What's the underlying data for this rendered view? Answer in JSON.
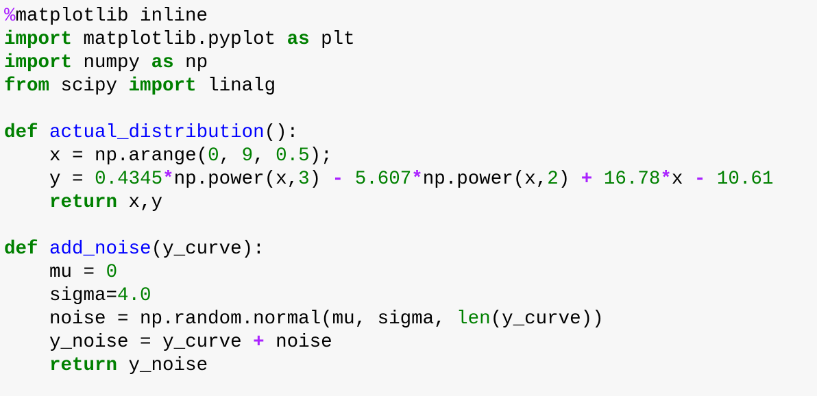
{
  "colors": {
    "background": "#f7f7f7",
    "keyword": "#008000",
    "function_name": "#0000ff",
    "number": "#008000",
    "operator": "#aa22ff",
    "text": "#000000"
  },
  "code_lines": [
    [
      {
        "text": "%",
        "kind": "magic"
      },
      {
        "text": "matplotlib inline",
        "kind": "t"
      }
    ],
    [
      {
        "text": "import",
        "kind": "kw"
      },
      {
        "text": " matplotlib.pyplot ",
        "kind": "t"
      },
      {
        "text": "as",
        "kind": "kw"
      },
      {
        "text": " plt",
        "kind": "t"
      }
    ],
    [
      {
        "text": "import",
        "kind": "kw"
      },
      {
        "text": " numpy ",
        "kind": "t"
      },
      {
        "text": "as",
        "kind": "kw"
      },
      {
        "text": " np",
        "kind": "t"
      }
    ],
    [
      {
        "text": "from",
        "kind": "kw"
      },
      {
        "text": " scipy ",
        "kind": "t"
      },
      {
        "text": "import",
        "kind": "kw"
      },
      {
        "text": " linalg",
        "kind": "t"
      }
    ],
    [],
    [
      {
        "text": "def",
        "kind": "kw"
      },
      {
        "text": " ",
        "kind": "t"
      },
      {
        "text": "actual_distribution",
        "kind": "fn"
      },
      {
        "text": "():",
        "kind": "t"
      }
    ],
    [
      {
        "text": "    x ",
        "kind": "t"
      },
      {
        "text": "=",
        "kind": "t"
      },
      {
        "text": " np.arange(",
        "kind": "t"
      },
      {
        "text": "0",
        "kind": "num"
      },
      {
        "text": ", ",
        "kind": "t"
      },
      {
        "text": "9",
        "kind": "num"
      },
      {
        "text": ", ",
        "kind": "t"
      },
      {
        "text": "0.5",
        "kind": "num"
      },
      {
        "text": ");",
        "kind": "t"
      }
    ],
    [
      {
        "text": "    y ",
        "kind": "t"
      },
      {
        "text": "=",
        "kind": "t"
      },
      {
        "text": " ",
        "kind": "t"
      },
      {
        "text": "0.4345",
        "kind": "num"
      },
      {
        "text": "*",
        "kind": "op"
      },
      {
        "text": "np.power(x,",
        "kind": "t"
      },
      {
        "text": "3",
        "kind": "num"
      },
      {
        "text": ") ",
        "kind": "t"
      },
      {
        "text": "-",
        "kind": "op"
      },
      {
        "text": " ",
        "kind": "t"
      },
      {
        "text": "5.607",
        "kind": "num"
      },
      {
        "text": "*",
        "kind": "op"
      },
      {
        "text": "np.power(x,",
        "kind": "t"
      },
      {
        "text": "2",
        "kind": "num"
      },
      {
        "text": ") ",
        "kind": "t"
      },
      {
        "text": "+",
        "kind": "op"
      },
      {
        "text": " ",
        "kind": "t"
      },
      {
        "text": "16.78",
        "kind": "num"
      },
      {
        "text": "*",
        "kind": "op"
      },
      {
        "text": "x ",
        "kind": "t"
      },
      {
        "text": "-",
        "kind": "op"
      },
      {
        "text": " ",
        "kind": "t"
      },
      {
        "text": "10.61",
        "kind": "num"
      }
    ],
    [
      {
        "text": "    ",
        "kind": "t"
      },
      {
        "text": "return",
        "kind": "kw"
      },
      {
        "text": " x,y",
        "kind": "t"
      }
    ],
    [],
    [
      {
        "text": "def",
        "kind": "kw"
      },
      {
        "text": " ",
        "kind": "t"
      },
      {
        "text": "add_noise",
        "kind": "fn"
      },
      {
        "text": "(y_curve):",
        "kind": "t"
      }
    ],
    [
      {
        "text": "    mu ",
        "kind": "t"
      },
      {
        "text": "=",
        "kind": "t"
      },
      {
        "text": " ",
        "kind": "t"
      },
      {
        "text": "0",
        "kind": "num"
      }
    ],
    [
      {
        "text": "    sigma",
        "kind": "t"
      },
      {
        "text": "=",
        "kind": "t"
      },
      {
        "text": "4.0",
        "kind": "num"
      }
    ],
    [
      {
        "text": "    noise ",
        "kind": "t"
      },
      {
        "text": "=",
        "kind": "t"
      },
      {
        "text": " np.random.normal(mu, sigma, ",
        "kind": "t"
      },
      {
        "text": "len",
        "kind": "builtin"
      },
      {
        "text": "(y_curve))",
        "kind": "t"
      }
    ],
    [
      {
        "text": "    y_noise ",
        "kind": "t"
      },
      {
        "text": "=",
        "kind": "t"
      },
      {
        "text": " y_curve ",
        "kind": "t"
      },
      {
        "text": "+",
        "kind": "op"
      },
      {
        "text": " noise",
        "kind": "t"
      }
    ],
    [
      {
        "text": "    ",
        "kind": "t"
      },
      {
        "text": "return",
        "kind": "kw"
      },
      {
        "text": " y_noise",
        "kind": "t"
      }
    ]
  ]
}
